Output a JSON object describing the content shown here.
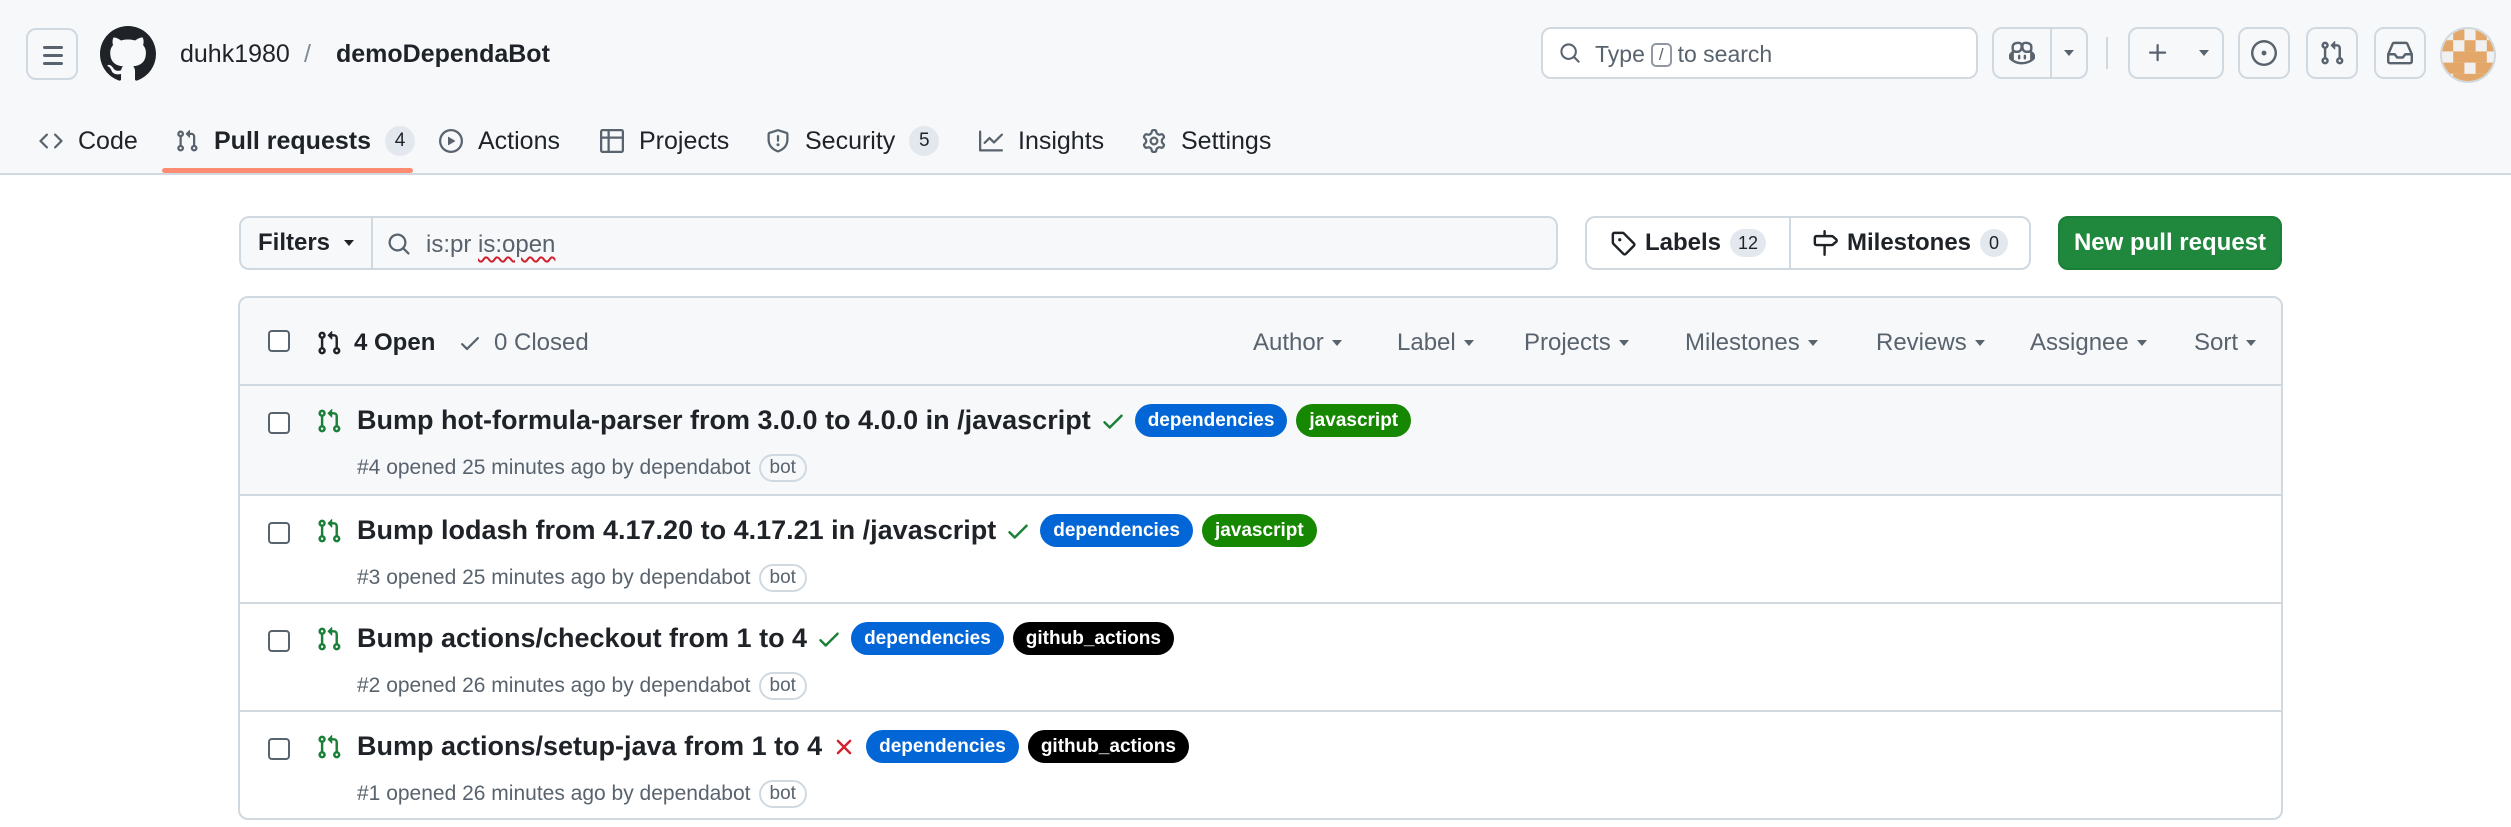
{
  "header": {
    "owner": "duhk1980",
    "separator": "/",
    "repo": "demoDependaBot",
    "search_text": "to search",
    "search_prefix": "Type",
    "search_key": "/"
  },
  "tabs": [
    {
      "label": "Code",
      "icon": "code-icon"
    },
    {
      "label": "Pull requests",
      "count": "4",
      "icon": "git-pull-request-icon",
      "active": true
    },
    {
      "label": "Actions",
      "icon": "play-icon"
    },
    {
      "label": "Projects",
      "icon": "table-icon"
    },
    {
      "label": "Security",
      "count": "5",
      "icon": "shield-icon"
    },
    {
      "label": "Insights",
      "icon": "graph-icon"
    },
    {
      "label": "Settings",
      "icon": "gear-icon"
    }
  ],
  "filterbar": {
    "filters_label": "Filters",
    "query_plain": "is:pr ",
    "query_underlined": "is:open",
    "labels_label": "Labels",
    "labels_count": "12",
    "milestones_label": "Milestones",
    "milestones_count": "0",
    "new_pr_label": "New pull request"
  },
  "list_header": {
    "open_label": "4 Open",
    "closed_label": "0 Closed",
    "filters": [
      "Author",
      "Label",
      "Projects",
      "Milestones",
      "Reviews",
      "Assignee",
      "Sort"
    ]
  },
  "pull_requests": [
    {
      "title": "Bump hot-formula-parser from 3.0.0 to 4.0.0 in /javascript",
      "status": "success",
      "labels": [
        {
          "name": "dependencies",
          "color": "#0366d6"
        },
        {
          "name": "javascript",
          "color": "#168700"
        }
      ],
      "meta": "#4 opened 25 minutes ago by dependabot",
      "badge": "bot"
    },
    {
      "title": "Bump lodash from 4.17.20 to 4.17.21 in /javascript",
      "status": "success",
      "labels": [
        {
          "name": "dependencies",
          "color": "#0366d6"
        },
        {
          "name": "javascript",
          "color": "#168700"
        }
      ],
      "meta": "#3 opened 25 minutes ago by dependabot",
      "badge": "bot"
    },
    {
      "title": "Bump actions/checkout from 1 to 4",
      "status": "success",
      "labels": [
        {
          "name": "dependencies",
          "color": "#0366d6"
        },
        {
          "name": "github_actions",
          "color": "#000000"
        }
      ],
      "meta": "#2 opened 26 minutes ago by dependabot",
      "badge": "bot"
    },
    {
      "title": "Bump actions/setup-java from 1 to 4",
      "status": "failure",
      "labels": [
        {
          "name": "dependencies",
          "color": "#0366d6"
        },
        {
          "name": "github_actions",
          "color": "#000000"
        }
      ],
      "meta": "#1 opened 26 minutes ago by dependabot",
      "badge": "bot"
    }
  ],
  "colors": {
    "accent_underline": "#fd8c73",
    "primary_button": "#1f883d",
    "success": "#1a7f37",
    "failure": "#d1242f"
  }
}
